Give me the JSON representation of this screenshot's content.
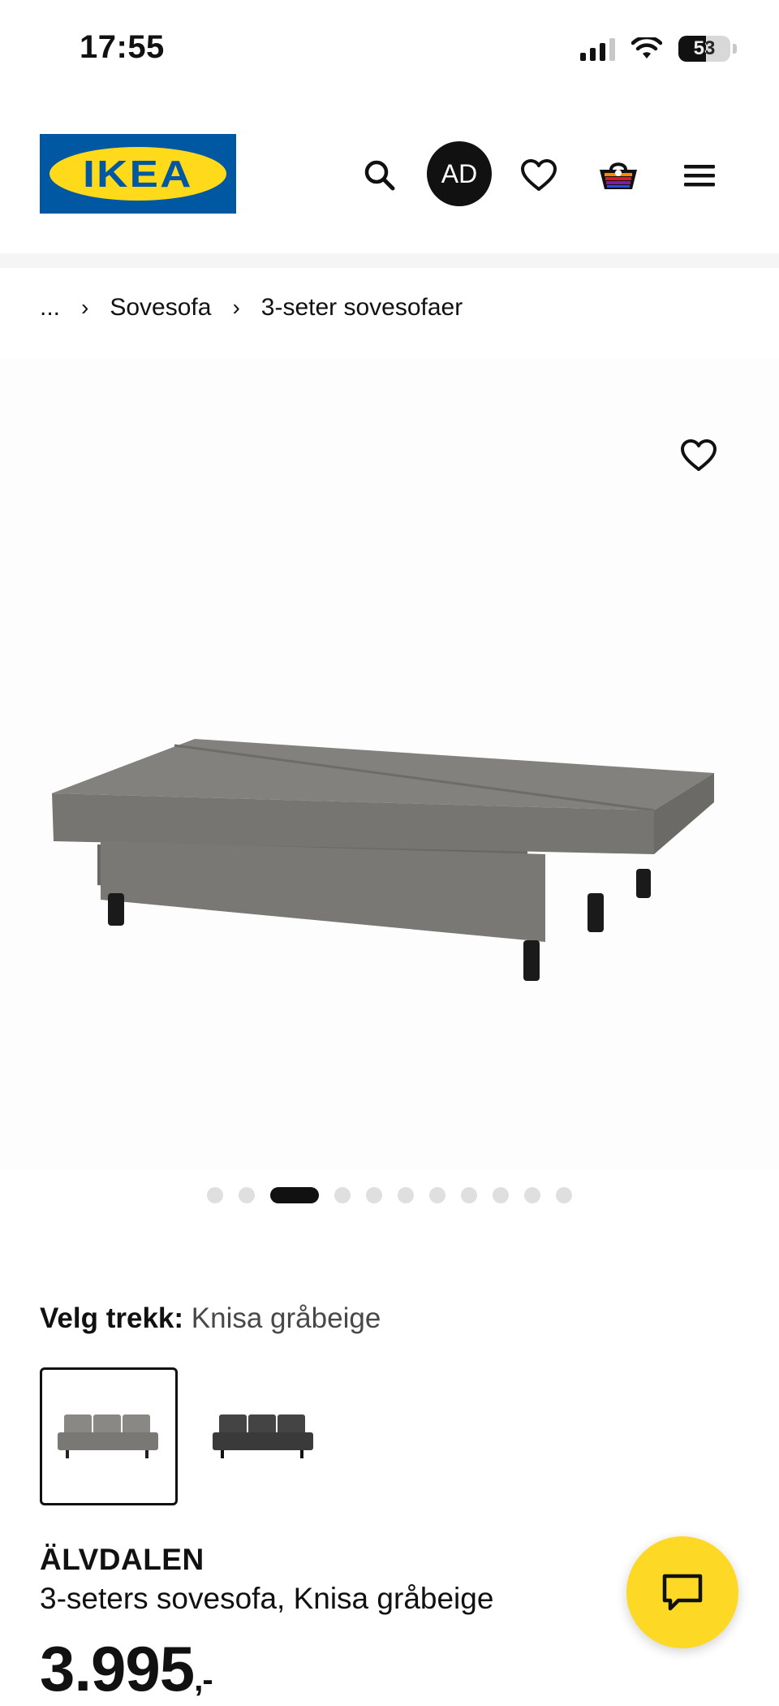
{
  "status_bar": {
    "time": "17:55",
    "battery": "53",
    "battery_level": 0.53
  },
  "header": {
    "logo_text": "IKEA",
    "avatar_initials": "AD"
  },
  "breadcrumb": {
    "ellipsis": "...",
    "items": [
      "Sovesofa",
      "3-seter sovesofaer"
    ]
  },
  "carousel": {
    "dot_count": 11,
    "active_index": 2
  },
  "variant": {
    "label": "Velg trekk:",
    "selected_value": "Knisa gråbeige"
  },
  "product": {
    "name": "ÄLVDALEN",
    "description": "3-seters sovesofa, Knisa gråbeige",
    "price": "3.995",
    "price_suffix": ",-"
  },
  "colors": {
    "ikea_blue": "#0058a3",
    "ikea_yellow": "#ffda1a",
    "chat_yellow": "#fdd926",
    "sofa_grey": "#7b7975",
    "sofa_dark": "#3a3a3a"
  },
  "icons": [
    "search-icon",
    "heart-icon",
    "shopping-bag-icon",
    "hamburger-menu-icon",
    "chevron-right-icon",
    "chat-icon",
    "wifi-icon",
    "signal-icon",
    "battery-icon"
  ]
}
